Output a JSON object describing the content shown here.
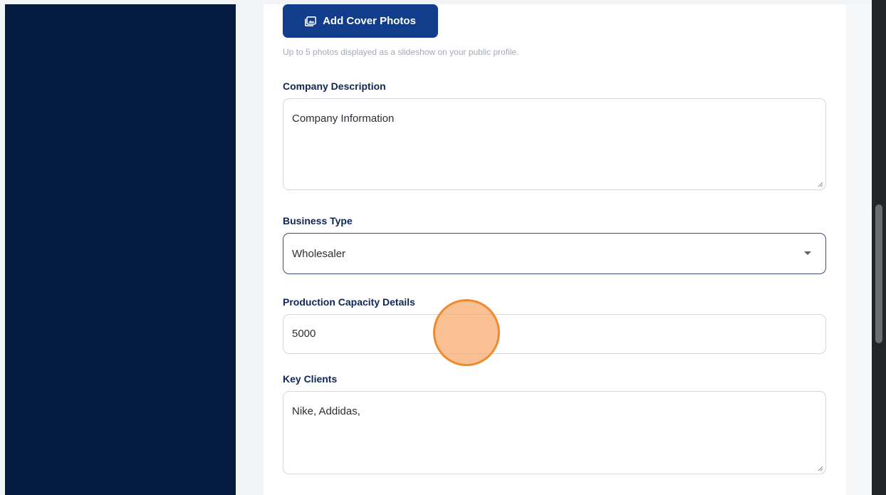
{
  "media": {
    "add_cover_label": "Add Cover Photos",
    "hint": "Up to 5 photos displayed as a slideshow on your public profile."
  },
  "company_description": {
    "label": "Company Description",
    "value": "Company Information"
  },
  "business_type": {
    "label": "Business Type",
    "value": "Wholesaler"
  },
  "production_capacity": {
    "label": "Production Capacity Details",
    "value": "5000"
  },
  "key_clients": {
    "label": "Key Clients",
    "value": "Nike, Addidas,"
  },
  "colors": {
    "sidebar": "#051a3f",
    "primary_button": "#123d8a",
    "label": "#0f2654",
    "cursor_highlight": "#f08a2e"
  }
}
